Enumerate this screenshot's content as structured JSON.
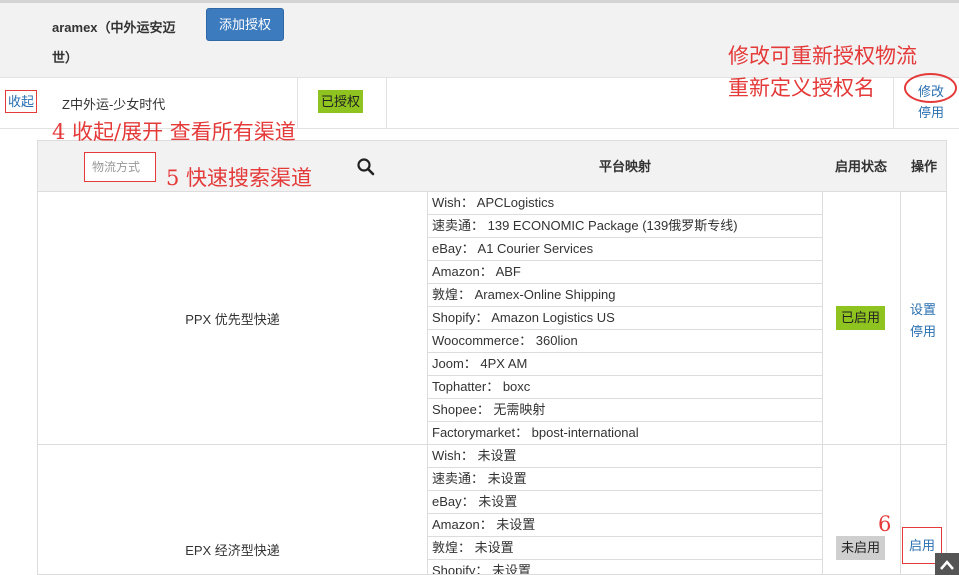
{
  "carrier": {
    "name_line1": "aramex（中外运安迈",
    "name_line2": "世）",
    "add_auth_label": "添加授权"
  },
  "auth": {
    "collapse_label": "收起",
    "name": "Z中外运-少女时代",
    "status": "已授权",
    "edit_label": "修改",
    "disable_label": "停用"
  },
  "annotations": {
    "edit_hint_line1": "修改可重新授权物流",
    "edit_hint_line2": "重新定义授权名",
    "collapse_hint": "4 收起/展开 查看所有渠道",
    "search_hint": "5 快速搜索渠道",
    "enable_hint": "6"
  },
  "table": {
    "search_placeholder": "物流方式",
    "headers": {
      "mapping": "平台映射",
      "status": "启用状态",
      "ops": "操作"
    },
    "rows": [
      {
        "name": "PPX 优先型快递",
        "mappings": [
          "Wish： APCLogistics",
          "速卖通： 139 ECONOMIC Package (139俄罗斯专线)",
          "eBay： A1 Courier Services",
          "Amazon： ABF",
          "敦煌： Aramex-Online Shipping",
          "Shopify： Amazon Logistics US",
          "Woocommerce： 360lion",
          "Joom： 4PX AM",
          "Tophatter： boxc",
          "Shopee： 无需映射",
          "Factorymarket： bpost-international"
        ],
        "status": "已启用",
        "op_set": "设置",
        "op_disable": "停用"
      },
      {
        "name": "EPX 经济型快递",
        "mappings": [
          "Wish： 未设置",
          "速卖通： 未设置",
          "eBay： 未设置",
          "Amazon： 未设置",
          "敦煌： 未设置",
          "Shopify： 未设置"
        ],
        "status": "未启用",
        "op_enable": "启用"
      }
    ]
  },
  "colors": {
    "accent_blue": "#3d7bbf",
    "link_blue": "#2a6fb0",
    "status_green": "#8fc31f",
    "annotation_red": "#e43a3a"
  }
}
